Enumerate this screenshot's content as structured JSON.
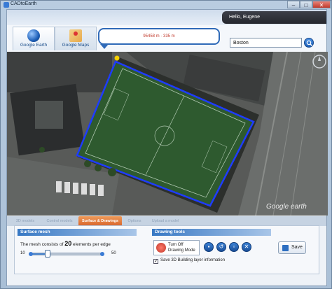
{
  "window": {
    "title": "CADtoEarth",
    "min_label": "–",
    "max_label": "□",
    "close_label": "✕"
  },
  "user": {
    "greeting": "Hello, Eugene"
  },
  "map_tabs": [
    {
      "label": "Google Earth",
      "icon": "google-earth-icon"
    },
    {
      "label": "Google Maps",
      "icon": "google-maps-icon"
    }
  ],
  "measure": {
    "text": "95458 m · 335 m"
  },
  "search": {
    "value": "Boston",
    "icon": "search-icon"
  },
  "map": {
    "brand": "Google earth"
  },
  "section_tabs": [
    {
      "label": "3D models",
      "active": false
    },
    {
      "label": "Control models",
      "active": false
    },
    {
      "label": "Surface & Drawings",
      "active": true
    },
    {
      "label": "Options",
      "active": false
    },
    {
      "label": "Upload a model",
      "active": false
    }
  ],
  "surface_mesh": {
    "title": "Surface mesh",
    "text_before": "The mesh consists of ",
    "count": "20",
    "text_after": " elements per edge",
    "min": "10",
    "max": "50",
    "value": 20
  },
  "drawing_tools": {
    "title": "Drawing tools",
    "turn_off_label": "Turn Off Drawing Mode",
    "tools": [
      "save-drawing-icon",
      "undo-icon",
      "clear-icon",
      "delete-icon"
    ],
    "checkbox_label": "Save 3D Building layer information",
    "checkbox_checked": true
  },
  "save": {
    "label": "Save"
  },
  "colors": {
    "accent": "#2f6ab8",
    "active_tab": "#d8642b",
    "polygon": "#1e3cff"
  }
}
